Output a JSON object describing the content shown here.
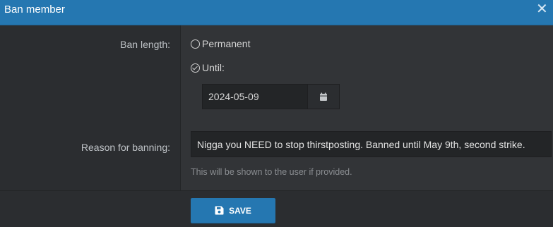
{
  "dialog": {
    "title": "Ban member",
    "close_icon": "close-icon",
    "title_bar_color": "#2577b1"
  },
  "ban_length": {
    "label": "Ban length:",
    "options": [
      {
        "label": "Permanent",
        "selected": false
      },
      {
        "label": "Until:",
        "selected": true
      }
    ],
    "date_value": "2024-05-09",
    "calendar_icon": "calendar-icon"
  },
  "reason": {
    "label": "Reason for banning:",
    "value": "Nigga you NEED to stop thirstposting. Banned until May 9th, second strike.",
    "hint": "This will be shown to the user if provided."
  },
  "footer": {
    "save_label": "SAVE",
    "save_icon": "save-icon",
    "save_color": "#2577b1"
  }
}
